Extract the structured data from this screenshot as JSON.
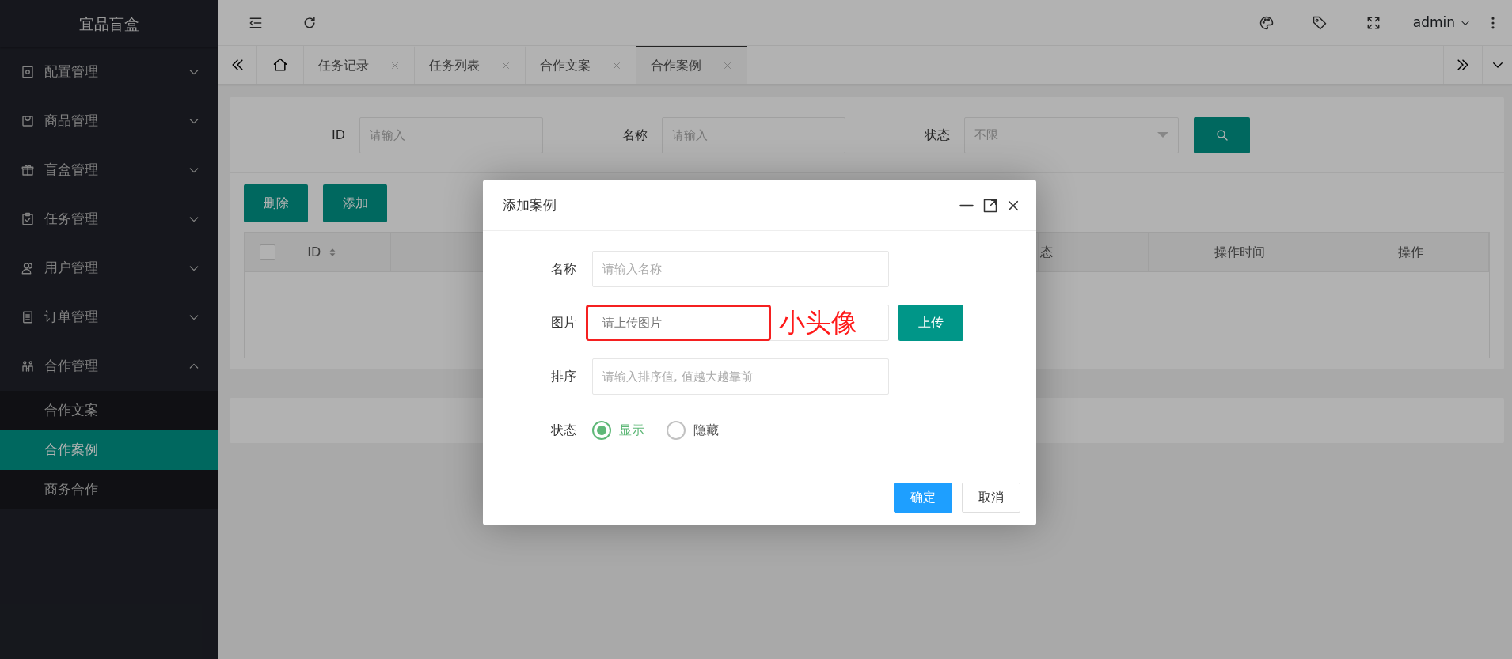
{
  "sidebar": {
    "logo": "宜品盲盒",
    "items": [
      {
        "label": "配置管理",
        "expanded": false
      },
      {
        "label": "商品管理",
        "expanded": false
      },
      {
        "label": "盲盒管理",
        "expanded": false
      },
      {
        "label": "任务管理",
        "expanded": false
      },
      {
        "label": "用户管理",
        "expanded": false
      },
      {
        "label": "订单管理",
        "expanded": false
      },
      {
        "label": "合作管理",
        "expanded": true,
        "children": [
          {
            "label": "合作文案",
            "selected": false
          },
          {
            "label": "合作案例",
            "selected": true
          },
          {
            "label": "商务合作",
            "selected": false
          }
        ]
      }
    ]
  },
  "header": {
    "user": "admin"
  },
  "tabs": [
    {
      "label": "任务记录",
      "selected": false
    },
    {
      "label": "任务列表",
      "selected": false
    },
    {
      "label": "合作文案",
      "selected": false
    },
    {
      "label": "合作案例",
      "selected": true
    }
  ],
  "search": {
    "fields": [
      {
        "label": "ID",
        "kind": "input",
        "placeholder": "请输入"
      },
      {
        "label": "名称",
        "kind": "input",
        "placeholder": "请输入"
      },
      {
        "label": "状态",
        "kind": "select",
        "placeholder": "不限"
      }
    ]
  },
  "toolbar": [
    "删除",
    "添加"
  ],
  "table": {
    "columns": [
      {
        "kind": "checkbox",
        "checked": false
      },
      {
        "kind": "sort",
        "label": "ID"
      },
      {
        "kind": "hidden"
      },
      {
        "kind": "text",
        "label": "态"
      },
      {
        "kind": "text",
        "label": "操作时间"
      },
      {
        "kind": "text",
        "label": "操作"
      }
    ]
  },
  "dialog": {
    "title": "添加案例",
    "fields": [
      {
        "label": "名称",
        "kind": "input",
        "placeholder": "请输入名称"
      },
      {
        "label": "图片",
        "kind": "upload",
        "placeholder": "请上传图片",
        "button": "上传",
        "annotation": "小头像"
      },
      {
        "label": "排序",
        "kind": "input",
        "placeholder": "请输入排序值, 值越大越靠前"
      },
      {
        "label": "状态",
        "kind": "radio",
        "options": [
          {
            "label": "显示",
            "selected": true
          },
          {
            "label": "隐藏",
            "selected": false
          }
        ]
      }
    ],
    "buttons": [
      {
        "label": "确定",
        "kind": "primary"
      },
      {
        "label": "取消",
        "kind": "default"
      }
    ]
  }
}
